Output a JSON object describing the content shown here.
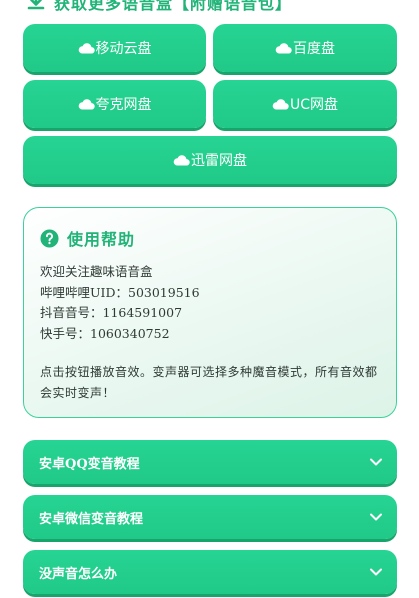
{
  "download_section": {
    "title": "获取更多语音盒【附赠语音包】",
    "icon": "download-icon"
  },
  "cloud_buttons": [
    {
      "label": "移动云盘",
      "icon": "cloud-icon"
    },
    {
      "label": "百度盘",
      "icon": "cloud-icon"
    },
    {
      "label": "夸克网盘",
      "icon": "cloud-icon"
    },
    {
      "label": "UC网盘",
      "icon": "cloud-icon"
    },
    {
      "label": "迅雷网盘",
      "icon": "cloud-icon"
    }
  ],
  "help": {
    "title": "使用帮助",
    "icon": "question-circle-icon",
    "lines": [
      "欢迎关注趣味语音盒",
      "哔哩哔哩UID：503019516",
      "抖音音号：1164591007",
      "快手号：1060340752"
    ],
    "note": "点击按钮播放音效。变声器可选择多种魔音模式，所有音效都会实时变声！"
  },
  "accordion": [
    {
      "label": "安卓QQ变音教程",
      "icon": "chevron-down-icon"
    },
    {
      "label": "安卓微信变音教程",
      "icon": "chevron-down-icon"
    },
    {
      "label": "没声音怎么办",
      "icon": "chevron-down-icon"
    }
  ],
  "colors": {
    "accent": "#21b377",
    "button": "#22cc8a",
    "button_shadow": "#17a56c",
    "card_border": "#3bd29a"
  }
}
